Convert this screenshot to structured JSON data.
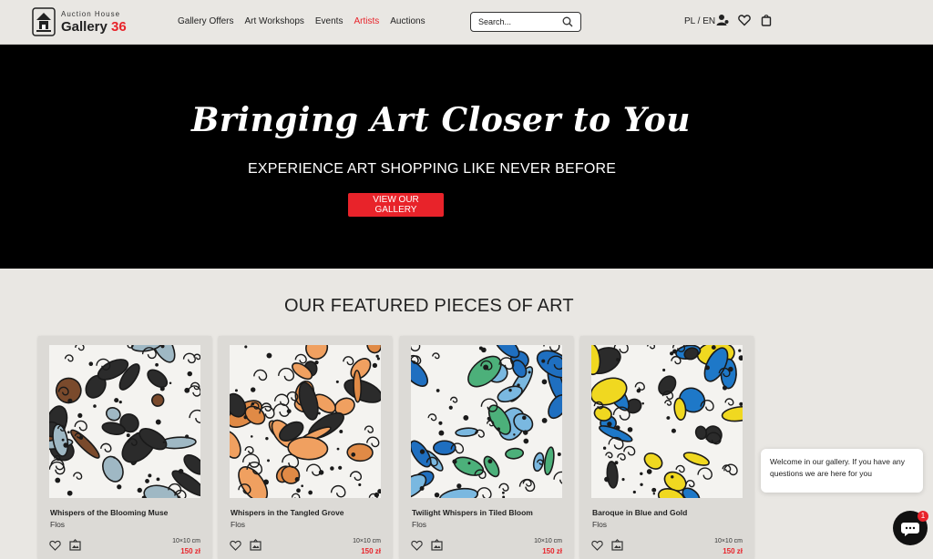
{
  "header": {
    "logo": {
      "top": "Auction House",
      "name": "Gallery",
      "number": "36"
    },
    "nav": [
      {
        "label": "Gallery Offers",
        "active": false
      },
      {
        "label": "Art Workshops",
        "active": false
      },
      {
        "label": "Events",
        "active": false
      },
      {
        "label": "Artists",
        "active": true
      },
      {
        "label": "Auctions",
        "active": false
      }
    ],
    "search": {
      "placeholder": "Search..."
    },
    "language": "PL / EN",
    "icons": [
      "user-icon",
      "heart-icon",
      "bag-icon"
    ]
  },
  "hero": {
    "title": "Bringing Art Closer to You",
    "subtitle": "EXPERIENCE ART SHOPPING LIKE NEVER BEFORE",
    "button": "VIEW OUR GALLERY"
  },
  "featured": {
    "title": "OUR FEATURED PIECES OF ART",
    "items": [
      {
        "title": "Whispers of the Blooming Muse",
        "artist": "Flos",
        "size": "10×10 cm",
        "price": "150 zł",
        "palette": [
          "#7a4a2c",
          "#9fb8c4",
          "#2b2b2b"
        ]
      },
      {
        "title": "Whispers in the Tangled Grove",
        "artist": "Flos",
        "size": "10×10 cm",
        "price": "150 zł",
        "palette": [
          "#e08a46",
          "#f0a060",
          "#2b2b2b"
        ]
      },
      {
        "title": "Twilight Whispers in Tiled Bloom",
        "artist": "Flos",
        "size": "10×10 cm",
        "price": "150 zł",
        "palette": [
          "#1f6fc0",
          "#4cb07a",
          "#7ab8e0"
        ]
      },
      {
        "title": "Baroque in Blue and Gold",
        "artist": "Flos",
        "size": "10×10 cm",
        "price": "150 zł",
        "palette": [
          "#f0d820",
          "#1e78c8",
          "#2b2b2b"
        ]
      }
    ]
  },
  "chat": {
    "message": "Welcome in our gallery. If you have any questions we are here for you",
    "badge": "1"
  },
  "colors": {
    "accent": "#e8232a",
    "hero_bg": "#000000",
    "page_bg": "#e9e7e3"
  }
}
